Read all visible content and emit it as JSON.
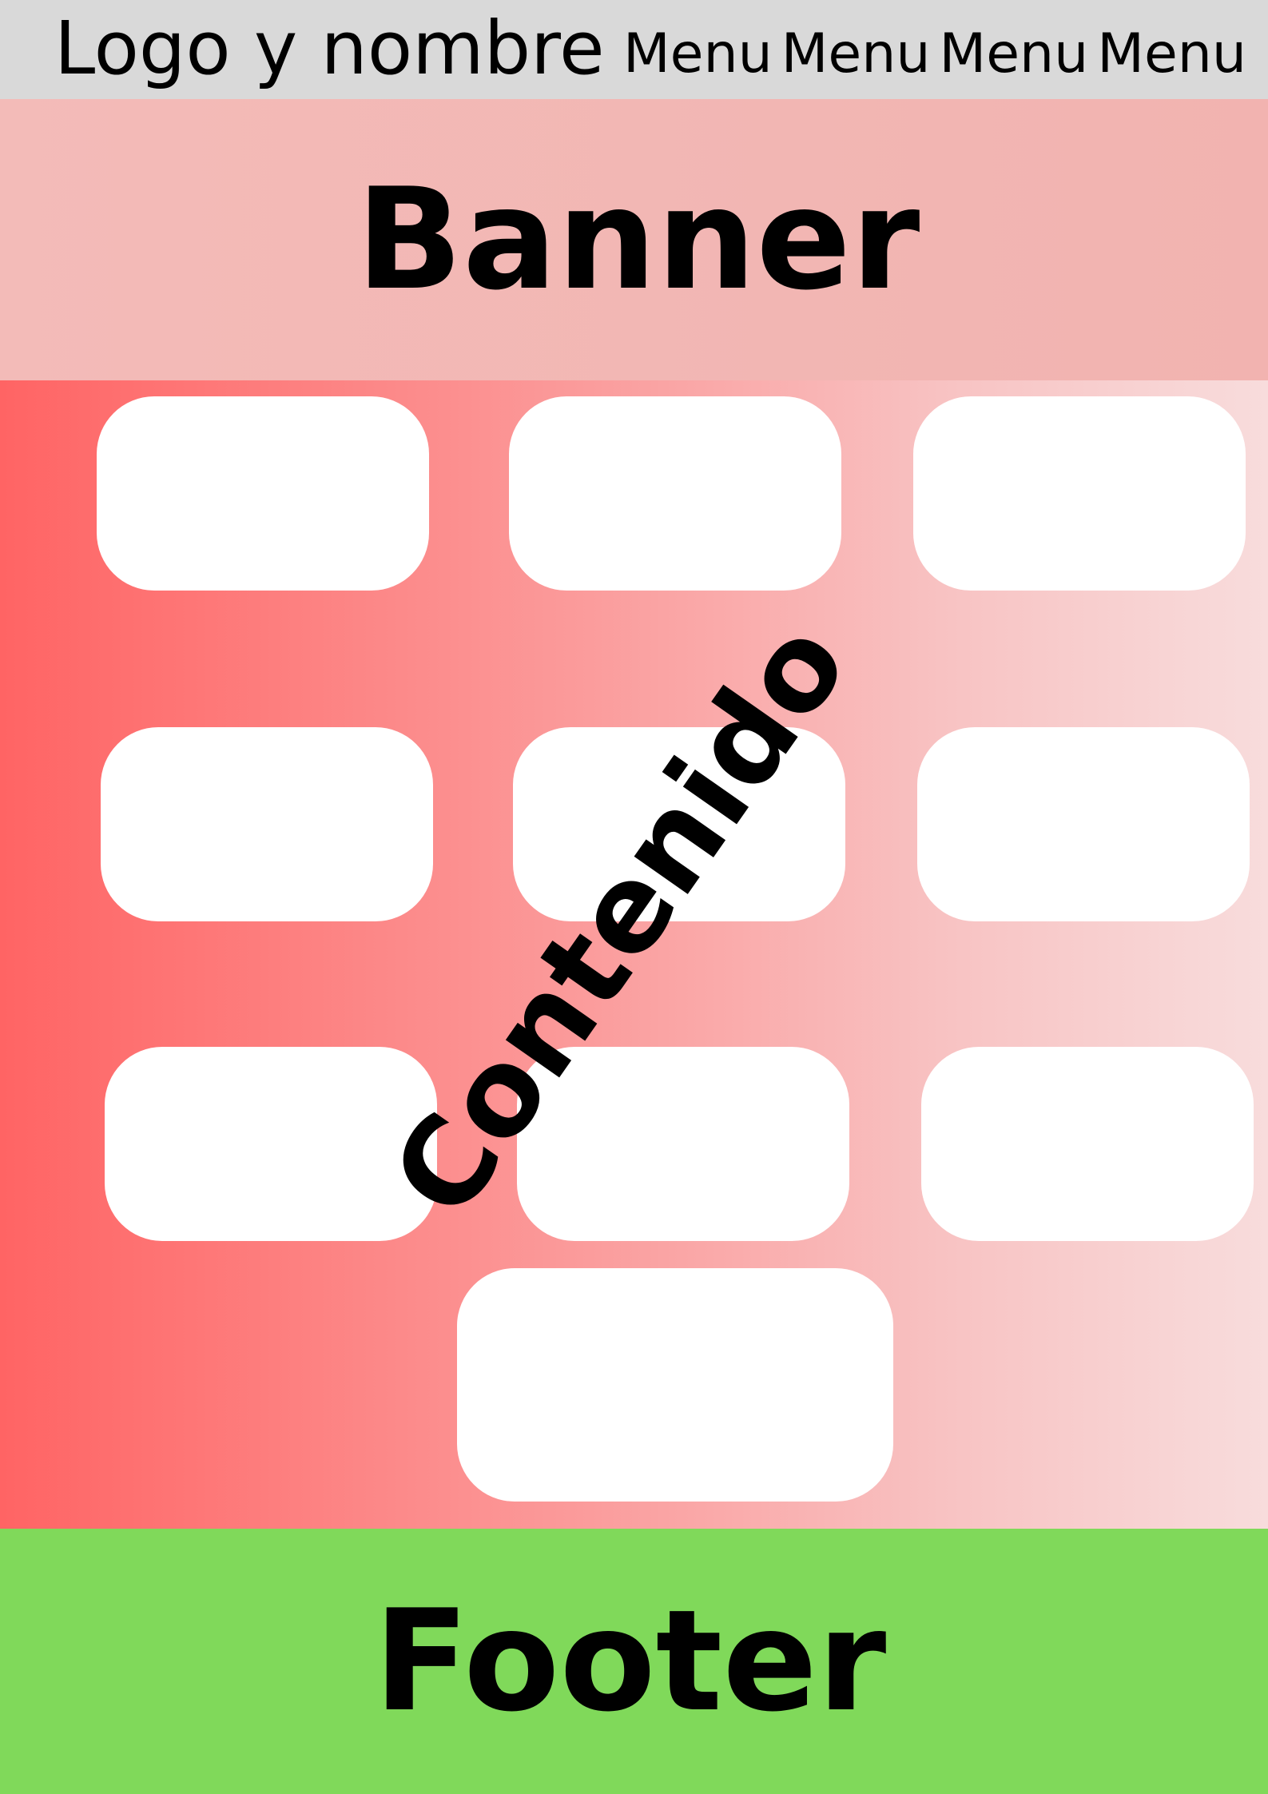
{
  "header": {
    "logo_text": "Logo y nombre",
    "menu": [
      "Menu",
      "Menu",
      "Menu",
      "Menu"
    ]
  },
  "banner": {
    "title": "Banner"
  },
  "content": {
    "label": "Contenido",
    "card_count": 10
  },
  "footer": {
    "title": "Footer"
  },
  "colors": {
    "header_bg": "#d9d9d9",
    "banner_bg": "#f3b8b5",
    "content_gradient_start": "#ff6464",
    "content_gradient_end": "#f8dcdc",
    "card_bg": "#ffffff",
    "footer_bg": "#80d95a"
  }
}
